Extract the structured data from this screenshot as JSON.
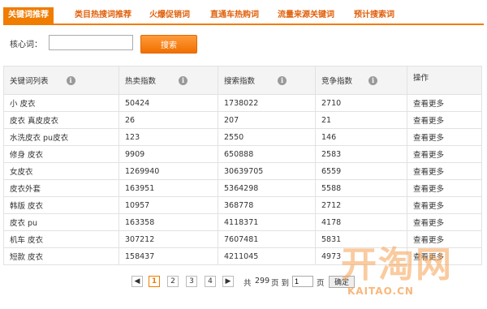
{
  "tabs": [
    {
      "label": "关键词推荐",
      "active": true
    },
    {
      "label": "类目热搜词推荐",
      "active": false
    },
    {
      "label": "火爆促销词",
      "active": false
    },
    {
      "label": "直通车热购词",
      "active": false
    },
    {
      "label": "流量来源关键词",
      "active": false
    },
    {
      "label": "预计搜索词",
      "active": false
    }
  ],
  "search": {
    "label": "核心词：",
    "value": "",
    "placeholder": "",
    "button_label": "搜索"
  },
  "table": {
    "headers": [
      "关键词列表",
      "热卖指数",
      "搜索指数",
      "竞争指数",
      "操作"
    ],
    "rows": [
      [
        "小 皮衣",
        "50424",
        "1738022",
        "2710",
        "查看更多"
      ],
      [
        "皮衣 真皮皮衣",
        "26",
        "207",
        "21",
        "查看更多"
      ],
      [
        "水洗皮衣 pu皮衣",
        "123",
        "2550",
        "146",
        "查看更多"
      ],
      [
        "修身 皮衣",
        "9909",
        "650888",
        "2583",
        "查看更多"
      ],
      [
        "女皮衣",
        "1269940",
        "30639705",
        "6559",
        "查看更多"
      ],
      [
        "皮衣外套",
        "163951",
        "5364298",
        "5588",
        "查看更多"
      ],
      [
        "韩版 皮衣",
        "10957",
        "368778",
        "2712",
        "查看更多"
      ],
      [
        "皮衣 pu",
        "163358",
        "4118371",
        "4178",
        "查看更多"
      ],
      [
        "机车 皮衣",
        "307212",
        "7607481",
        "5831",
        "查看更多"
      ],
      [
        "短款 皮衣",
        "158437",
        "4211045",
        "4973",
        "查看更多"
      ]
    ]
  },
  "pagination": {
    "prev": "◀",
    "pages": [
      "1",
      "2",
      "3",
      "4"
    ],
    "current": "1",
    "next": "▶",
    "total_prefix": "共",
    "total_pages": "299",
    "total_suffix": "页 到",
    "goto_value": "1",
    "page_label": "页",
    "confirm_label": "确定"
  },
  "watermark": {
    "brand": "开淘网",
    "url": "KAITAO.CN"
  },
  "colors": {
    "accent": "#f07c00",
    "tab_text": "#e0600b",
    "header_bg": "#f4f4f4",
    "border": "#e2e2e2"
  }
}
